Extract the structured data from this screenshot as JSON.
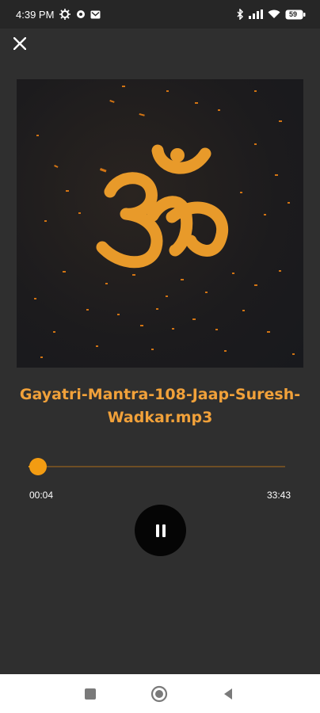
{
  "status_bar": {
    "time": "4:39 PM",
    "battery": "59"
  },
  "player": {
    "close_icon": "close-icon",
    "artwork_icon": "om-symbol-icon",
    "title": "Gayatri-Mantra-108-Jaap-Suresh-Wadkar.mp3",
    "progress_fraction": 0.003,
    "time_current": "00:04",
    "time_total": "33:43",
    "state": "playing",
    "pause_icon": "pause-icon"
  },
  "nav_bar": {
    "icons": [
      "recent-apps-icon",
      "home-icon",
      "back-icon"
    ]
  },
  "colors": {
    "accent": "#f39c12",
    "title": "#f1a13a",
    "background": "#2f2f2f",
    "button": "#050505"
  }
}
